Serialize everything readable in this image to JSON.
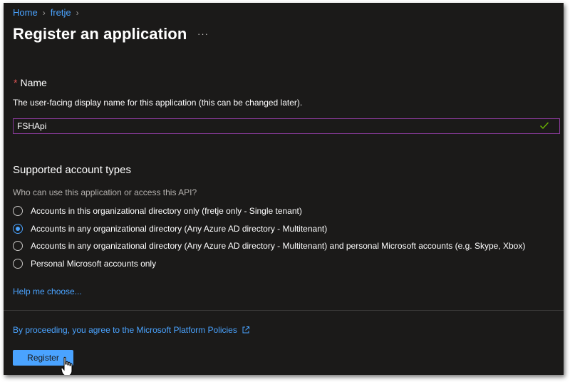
{
  "breadcrumb": {
    "items": [
      {
        "label": "Home"
      },
      {
        "label": "fretje"
      }
    ]
  },
  "page": {
    "title": "Register an application",
    "more_label": "···"
  },
  "name_section": {
    "required_mark": "*",
    "label": "Name",
    "description": "The user-facing display name for this application (this can be changed later).",
    "input_value": "FSHApi"
  },
  "account_types": {
    "heading": "Supported account types",
    "question": "Who can use this application or access this API?",
    "selected_index": 1,
    "options": [
      {
        "label": "Accounts in this organizational directory only (fretje only - Single tenant)"
      },
      {
        "label": "Accounts in any organizational directory (Any Azure AD directory - Multitenant)"
      },
      {
        "label": "Accounts in any organizational directory (Any Azure AD directory - Multitenant) and personal Microsoft accounts (e.g. Skype, Xbox)"
      },
      {
        "label": "Personal Microsoft accounts only"
      }
    ],
    "help_link": "Help me choose..."
  },
  "footer": {
    "policy_text": "By proceeding, you agree to the Microsoft Platform Policies",
    "register_label": "Register"
  },
  "colors": {
    "background": "#1b1a19",
    "link": "#4aa3ff",
    "input_border": "#8a3b9b",
    "check": "#6bb700",
    "required": "#e05555"
  }
}
